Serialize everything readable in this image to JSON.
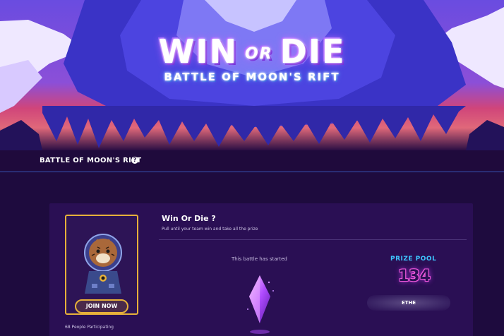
{
  "banner": {
    "title_main_left": "WIN",
    "title_or": "OR",
    "title_main_right": "DIE",
    "title_sub": "BATTLE OF MOON'S RIFT"
  },
  "subheader": {
    "title": "BATTLE OF MOON'S RIFT",
    "info_icon": "info-icon",
    "info_glyph": "?"
  },
  "card": {
    "join_label": "JOIN NOW",
    "participants": "68 People Participating",
    "title": "Win Or Die ?",
    "description": "Pull until your team win and take all the prize",
    "status": "This battle has started",
    "prize_pool_label": "PRIZE POOL",
    "prize_pool_value": "134",
    "prize_pool_unit": "ETHE"
  },
  "colors": {
    "background": "#1e0b3e",
    "card": "#2a0f54",
    "gold_border": "#e7b13a",
    "prize_label": "#3ec6ff",
    "prize_value_glow": "#e74ad8",
    "divider_line": "#3656b8"
  }
}
